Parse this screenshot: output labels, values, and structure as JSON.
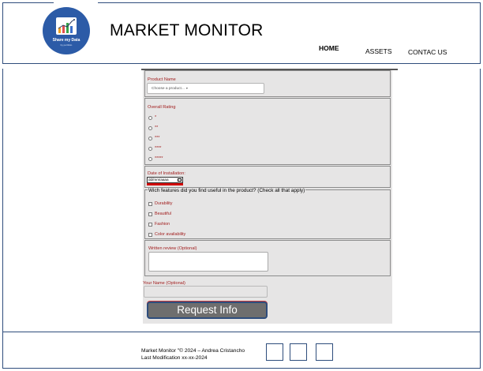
{
  "header": {
    "logo": {
      "title": "Share my Data",
      "subtitle": "by portfolio",
      "icon": "bar-chart-trend-icon",
      "brand_color": "#2c5ba7"
    },
    "site_title": "MARKET MONITOR",
    "nav": [
      {
        "label": "HOME",
        "active": true
      },
      {
        "label": "ASSETS",
        "active": false
      },
      {
        "label": "CONTAC US",
        "active": false
      }
    ]
  },
  "form": {
    "product": {
      "label": "Product Name",
      "selected": "Choose a product...",
      "caret": "▾"
    },
    "rating": {
      "label": "Overall Rating",
      "options": [
        "*",
        "**",
        "***",
        "****",
        "*****"
      ]
    },
    "installation": {
      "label": "Date of Installation:",
      "value": "dd/mm/aaaa"
    },
    "features": {
      "legend": "Wich features did you find useful in the product? (Check all that apply)",
      "options": [
        "Durability",
        "Beautiful",
        "Fashion",
        "Color availability"
      ]
    },
    "review": {
      "label": "Written review (Optional)"
    },
    "name": {
      "label": "Your Name (Optional)"
    },
    "submit_label": "Request Info"
  },
  "footer": {
    "copyright": "Market Monitor \"© 2024 – Andrea Cristancho",
    "last_modified": "Last Modification xx-xx-2024",
    "social_icons": [
      "social-icon-1",
      "social-icon-2",
      "social-icon-3"
    ]
  },
  "colors": {
    "accent_border": "#2e4d7c",
    "label_red": "#a11d1d",
    "form_background": "#e6e5e5",
    "button_gray": "#6e6e6e"
  }
}
